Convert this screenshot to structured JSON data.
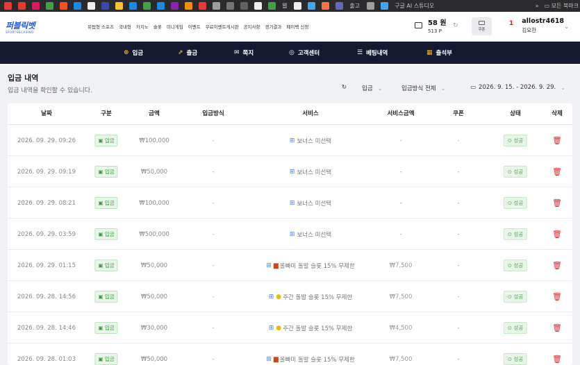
{
  "browser": {
    "bookmark_texts": [
      "웹",
      "출고",
      "구글 AI 스튜디오"
    ],
    "right_overflow": "»",
    "right_folder": "모든 북마크"
  },
  "header": {
    "logo_text": "퍼블릭벳",
    "logo_sub": "SPORTS&CASINO",
    "nav": [
      "유럽형 스포츠",
      "국내형",
      "카지노",
      "슬롯",
      "미니게임",
      "이벤트",
      "무료이벤트게시판",
      "공지사항",
      "경기결과",
      "페이백 신청"
    ],
    "wallet_won": "58 원",
    "wallet_points": "513 P",
    "coupon_label": "쿠폰",
    "user_level": "1",
    "user_id": "allostr4618",
    "user_name": "김요한"
  },
  "darknav": {
    "items": [
      {
        "label": "입금",
        "icon": "coin-icon"
      },
      {
        "label": "출금",
        "icon": "withdraw-icon"
      },
      {
        "label": "쪽지",
        "icon": "mail-icon"
      },
      {
        "label": "고객센터",
        "icon": "headset-icon"
      },
      {
        "label": "베팅내역",
        "icon": "list-icon"
      },
      {
        "label": "출석부",
        "icon": "calendar-icon"
      }
    ],
    "accent": "#f5b400"
  },
  "page": {
    "title": "입금 내역",
    "subtitle": "입금 내역을 확인할 수 있습니다.",
    "filter_type": "입금",
    "filter_method": "입금방식 전체",
    "date_range": "2026. 9. 15. - 2026. 9. 29."
  },
  "table": {
    "columns": [
      "날짜",
      "구분",
      "금액",
      "입금방식",
      "서비스",
      "서비스금액",
      "쿠폰",
      "상태",
      "삭제"
    ],
    "rows": [
      {
        "date": "2026. 09. 29. 09:26",
        "type": "입금",
        "amount": "₩100,000",
        "method": "-",
        "service_emoji": "",
        "service": "보너스 미선택",
        "service_amount": "-",
        "coupon": "-",
        "status": "성공"
      },
      {
        "date": "2026. 09. 29. 09:19",
        "type": "입금",
        "amount": "₩50,000",
        "method": "-",
        "service_emoji": "",
        "service": "보너스 미선택",
        "service_amount": "-",
        "coupon": "-",
        "status": "성공"
      },
      {
        "date": "2026. 09. 29. 08:21",
        "type": "입금",
        "amount": "₩100,000",
        "method": "-",
        "service_emoji": "",
        "service": "보너스 미선택",
        "service_amount": "-",
        "coupon": "-",
        "status": "성공"
      },
      {
        "date": "2026. 09. 29. 03:59",
        "type": "입금",
        "amount": "₩500,000",
        "method": "-",
        "service_emoji": "",
        "service": "보너스 미선택",
        "service_amount": "-",
        "coupon": "-",
        "status": "성공"
      },
      {
        "date": "2026. 09. 29. 01:15",
        "type": "입금",
        "amount": "₩50,000",
        "method": "-",
        "service_emoji": "bar",
        "service": "올빠미 돌발 슬롯 15% 무제한",
        "service_amount": "₩7,500",
        "coupon": "-",
        "status": "성공"
      },
      {
        "date": "2026. 09. 28. 14:56",
        "type": "입금",
        "amount": "₩50,000",
        "method": "-",
        "service_emoji": "sun",
        "service": "주간 돌발 슬롯 15% 무제한",
        "service_amount": "₩7,500",
        "coupon": "-",
        "status": "성공"
      },
      {
        "date": "2026. 09. 28. 14:46",
        "type": "입금",
        "amount": "₩30,000",
        "method": "-",
        "service_emoji": "sun",
        "service": "주간 돌발 슬롯 15% 무제한",
        "service_amount": "₩4,500",
        "coupon": "-",
        "status": "성공"
      },
      {
        "date": "2026. 09. 28. 01:03",
        "type": "입금",
        "amount": "₩50,000",
        "method": "-",
        "service_emoji": "bar",
        "service": "올빠미 돌발 슬롯 15% 무제한",
        "service_amount": "₩7,500",
        "coupon": "-",
        "status": "성공"
      }
    ]
  }
}
